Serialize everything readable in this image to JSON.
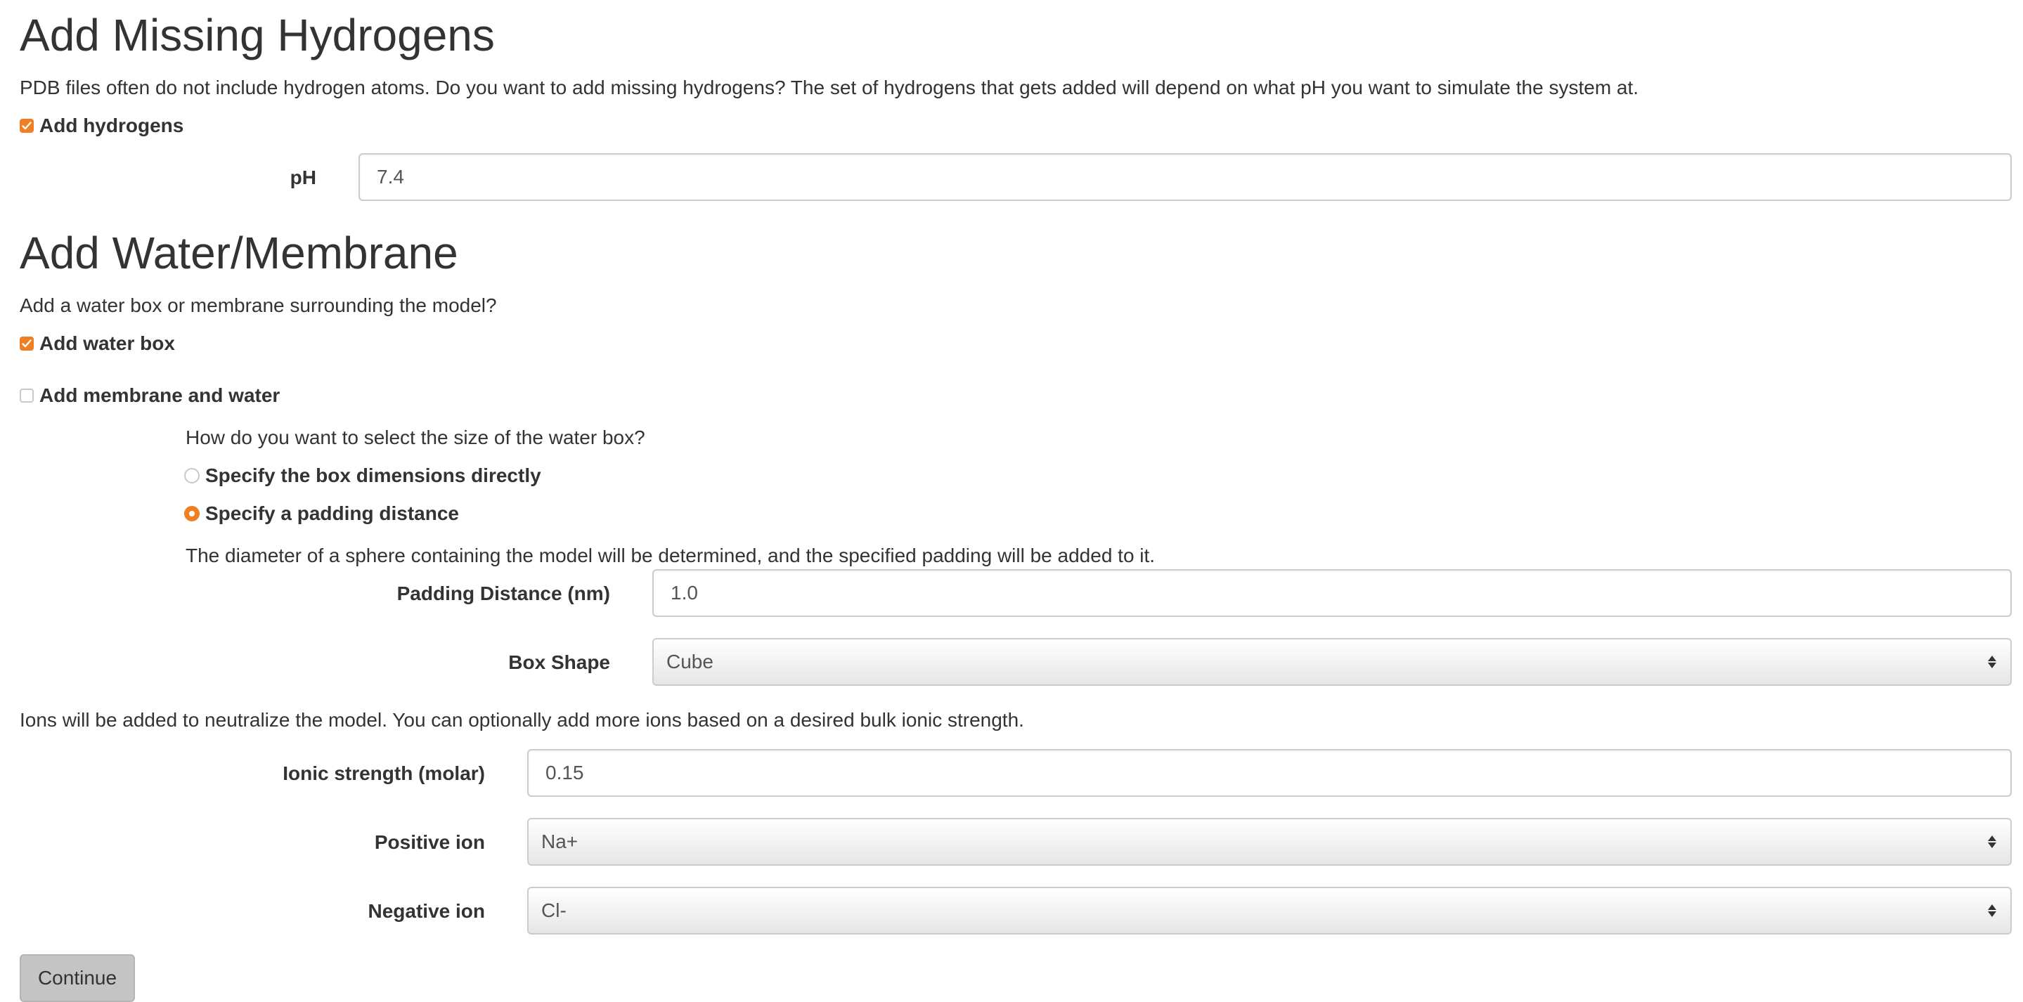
{
  "hydrogens": {
    "title": "Add Missing Hydrogens",
    "description": "PDB files often do not include hydrogen atoms. Do you want to add missing hydrogens? The set of hydrogens that gets added will depend on what pH you want to simulate the system at.",
    "add_hydrogens": {
      "label": "Add hydrogens",
      "checked": true
    },
    "ph": {
      "label": "pH",
      "value": "7.4"
    }
  },
  "water": {
    "title": "Add Water/Membrane",
    "description": "Add a water box or membrane surrounding the model?",
    "add_water_box": {
      "label": "Add water box",
      "checked": true
    },
    "add_membrane": {
      "label": "Add membrane and water",
      "checked": false
    },
    "size_question": "How do you want to select the size of the water box?",
    "size_options": [
      {
        "label": "Specify the box dimensions directly",
        "selected": false
      },
      {
        "label": "Specify a padding distance",
        "selected": true
      }
    ],
    "padding_note": "The diameter of a sphere containing the model will be determined, and the specified padding will be added to it.",
    "padding": {
      "label": "Padding Distance (nm)",
      "value": "1.0"
    },
    "box_shape": {
      "label": "Box Shape",
      "value": "Cube"
    }
  },
  "ions": {
    "description": "Ions will be added to neutralize the model. You can optionally add more ions based on a desired bulk ionic strength.",
    "ionic_strength": {
      "label": "Ionic strength (molar)",
      "value": "0.15"
    },
    "positive_ion": {
      "label": "Positive ion",
      "value": "Na+"
    },
    "negative_ion": {
      "label": "Negative ion",
      "value": "Cl-"
    }
  },
  "continue_button": {
    "label": "Continue"
  },
  "colors": {
    "accent": "#f07f23",
    "text": "#333333",
    "input_border": "#cccccc",
    "button_bg": "#c4c4c4"
  }
}
